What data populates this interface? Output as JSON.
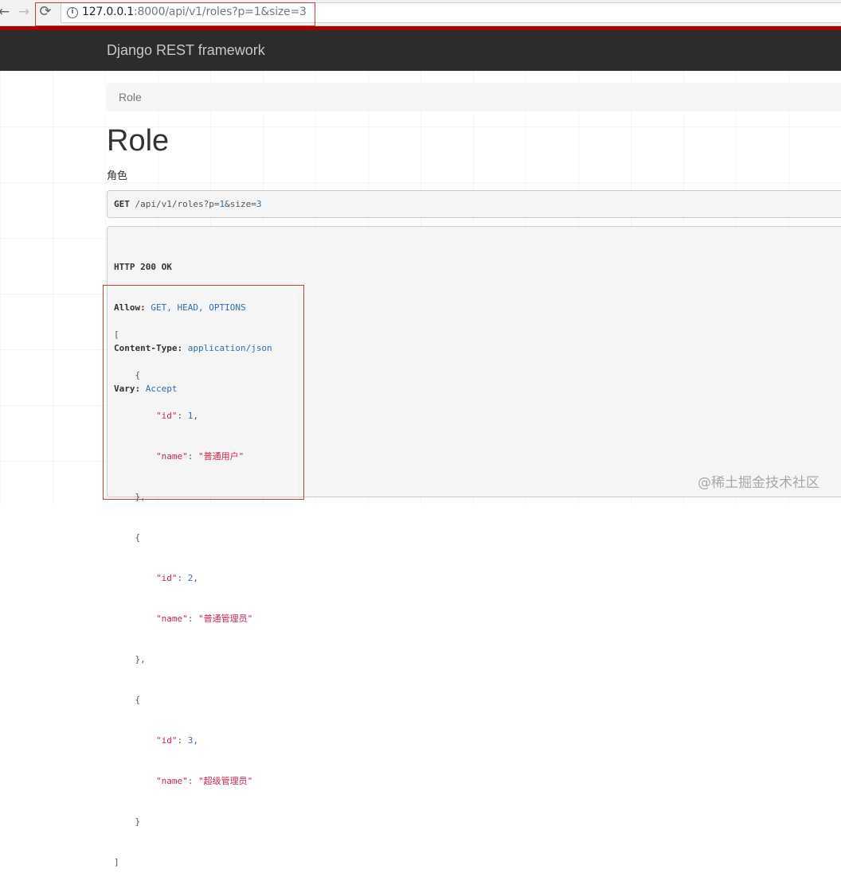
{
  "browser": {
    "url_host": "127.0.0.1",
    "url_rest": ":8000/api/v1/roles?p=1&size=3",
    "icons": {
      "back": "arrow-left-icon",
      "forward": "arrow-right-icon",
      "reload": "reload-icon",
      "info": "info-icon"
    }
  },
  "navbar": {
    "brand": "Django REST framework"
  },
  "breadcrumb": {
    "items": [
      "Role"
    ]
  },
  "content": {
    "title": "Role",
    "description": "角色"
  },
  "request": {
    "method": "GET",
    "path": "/api/v1/roles",
    "query_prefix": "?",
    "p_key": "p",
    "p_val": "1",
    "amp": "&",
    "size_key": "size",
    "size_val": "3"
  },
  "response": {
    "status": "HTTP 200 OK",
    "headers": [
      {
        "name": "Allow:",
        "value": "GET, HEAD, OPTIONS"
      },
      {
        "name": "Content-Type:",
        "value": "application/json"
      },
      {
        "name": "Vary:",
        "value": "Accept"
      }
    ],
    "body": [
      {
        "id": 1,
        "name": "普通用户"
      },
      {
        "id": 2,
        "name": "普通管理员"
      },
      {
        "id": 3,
        "name": "超级管理员"
      }
    ]
  },
  "watermark": "@稀土掘金技术社区",
  "colors": {
    "navbar": "#2c2c2c",
    "accent_red": "#a30000",
    "highlight_box": "#d43a3a",
    "json_string": "#c7254e",
    "json_number": "#2f6fad"
  }
}
